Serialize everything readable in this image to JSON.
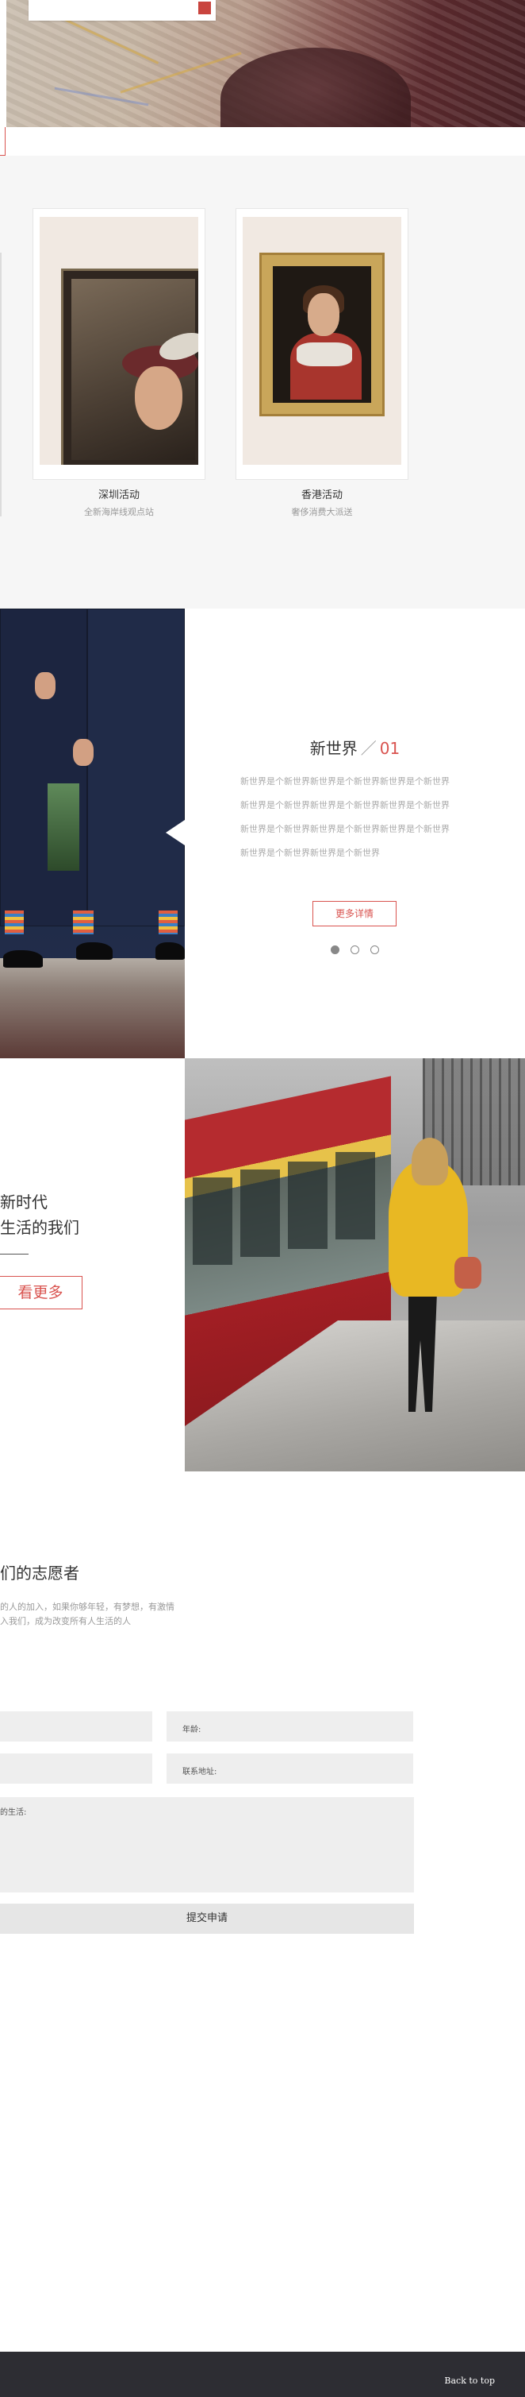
{
  "gallery": {
    "cards": [
      {
        "title": "深圳活动",
        "subtitle": "全新海岸线观点站"
      },
      {
        "title": "香港活动",
        "subtitle": "奢侈消费大派送"
      }
    ]
  },
  "new_world": {
    "title": "新世界",
    "separator": "／",
    "index": "01",
    "paragraph_lines": [
      "新世界是个新世界新世界是个新世界新世界是个新世界",
      "新世界是个新世界新世界是个新世界新世界是个新世界",
      "新世界是个新世界新世界是个新世界新世界是个新世界",
      "新世界是个新世界新世界是个新世界"
    ],
    "more_button": "更多详情",
    "slide_count": 3,
    "active_slide": 1
  },
  "new_era": {
    "line1": "新时代",
    "line2": "生活的我们",
    "button": "看更多"
  },
  "volunteer": {
    "title": "们的志愿者",
    "desc_line1": "的人的加入，如果你够年轻，有梦想，有激情",
    "desc_line2": "入我们，成为改变所有人生活的人",
    "fields": {
      "age_label": "年龄:",
      "address_label": "联系地址:",
      "life_label": "的生活:"
    },
    "submit": "提交申请"
  },
  "footer": {
    "back_to_top": "Back to top"
  },
  "colors": {
    "accent": "#d9534f",
    "footer_bg": "#2d2d33",
    "field_bg": "#eeeeee"
  }
}
